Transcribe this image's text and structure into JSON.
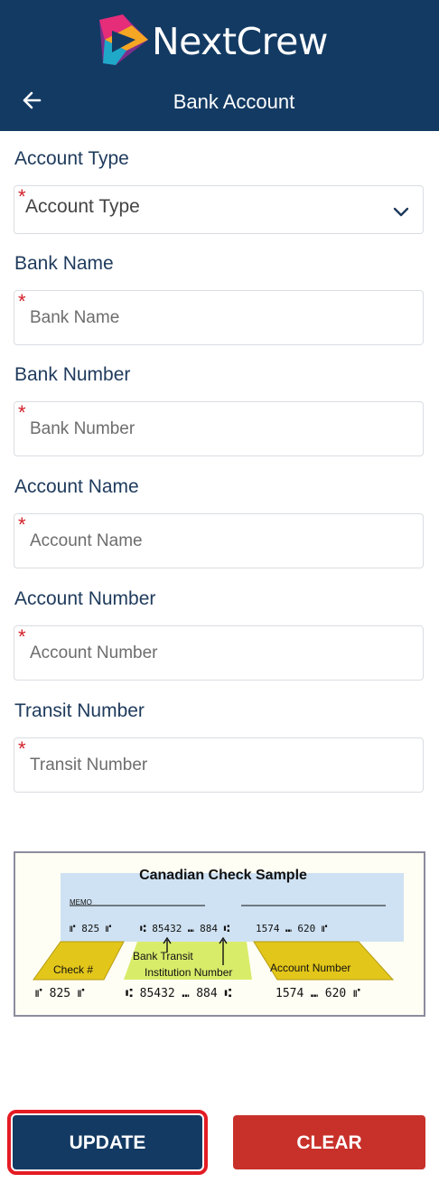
{
  "header": {
    "brand": "NextCrew",
    "title": "Bank Account"
  },
  "fields": [
    {
      "label": "Account Type",
      "placeholder": "Account Type"
    },
    {
      "label": "Bank Name",
      "placeholder": "Bank Name"
    },
    {
      "label": "Bank Number",
      "placeholder": "Bank Number"
    },
    {
      "label": "Account Name",
      "placeholder": "Account Name"
    },
    {
      "label": "Account Number",
      "placeholder": "Account Number"
    },
    {
      "label": "Transit Number",
      "placeholder": "Transit Number"
    }
  ],
  "required_mark": "*",
  "check_sample": {
    "title": "Canadian Check Sample",
    "memo": "MEMO",
    "micr_top": [
      "⑈ 825 ⑈",
      "⑆ 85432 ⑉ 884 ⑆",
      "1574 ⑉ 620 ⑈"
    ],
    "labels": [
      "Check #",
      "Bank Transit",
      "Institution Number",
      "Account Number"
    ],
    "micr_bottom": [
      "⑈ 825 ⑈",
      "⑆ 85432 ⑉ 884 ⑆",
      "1574 ⑉ 620 ⑈"
    ]
  },
  "buttons": {
    "update": "UPDATE",
    "clear": "CLEAR"
  },
  "colors": {
    "header": "#133a63",
    "required": "#d32027",
    "clear": "#c8302a",
    "highlight": "#e41b23"
  }
}
